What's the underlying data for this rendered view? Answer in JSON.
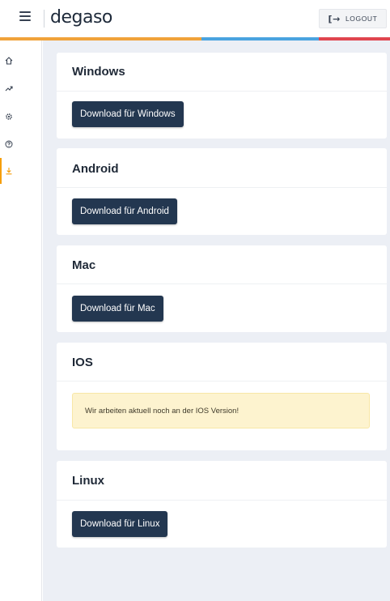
{
  "header": {
    "brand": "degaso",
    "logout_label": "LOGOUT",
    "logout_icon": "[→",
    "stripe_colors": [
      "#f0a23a",
      "#4aa3df",
      "#e0454f"
    ]
  },
  "sidebar": {
    "items": [
      {
        "icon": "home-icon"
      },
      {
        "icon": "trending-icon"
      },
      {
        "icon": "gear-icon"
      },
      {
        "icon": "help-icon"
      },
      {
        "icon": "download-icon",
        "active": true
      }
    ],
    "active_color": "#f59e0b"
  },
  "sections": {
    "windows": {
      "title": "Windows",
      "button": "Download für Windows"
    },
    "android": {
      "title": "Android",
      "button": "Download für Android"
    },
    "mac": {
      "title": "Mac",
      "button": "Download für Mac"
    },
    "ios": {
      "title": "IOS",
      "notice": "Wir arbeiten aktuell noch an der IOS Version!"
    },
    "linux": {
      "title": "Linux",
      "button": "Download für Linux"
    }
  },
  "colors": {
    "button_bg": "#233750",
    "notice_bg": "#fdf3cf",
    "page_bg": "#eceff5"
  }
}
